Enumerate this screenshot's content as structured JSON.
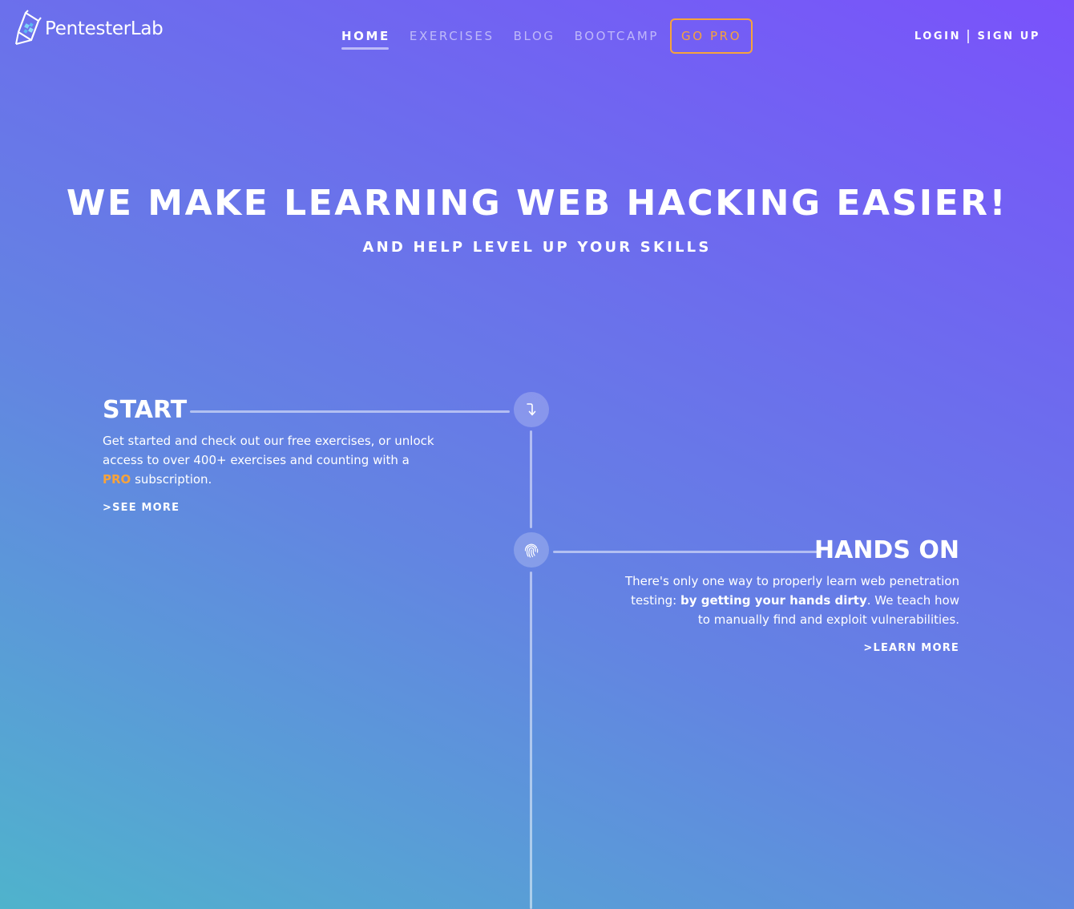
{
  "header": {
    "logo_text": "PentesterLab",
    "nav": [
      {
        "label": "HOME",
        "active": true
      },
      {
        "label": "EXERCISES",
        "active": false
      },
      {
        "label": "BLOG",
        "active": false
      },
      {
        "label": "BOOTCAMP",
        "active": false
      }
    ],
    "pro_label": "GO PRO",
    "login_label": "LOGIN",
    "separator": "|",
    "signup_label": "SIGN UP"
  },
  "hero": {
    "title": "WE MAKE LEARNING WEB HACKING EASIER!",
    "subtitle": "AND HELP LEVEL UP YOUR SKILLS"
  },
  "timeline": {
    "start": {
      "title": "START",
      "text_before": "Get started and check out our free exercises, or unlock access to over 400+ exercises and counting with a ",
      "highlight": "PRO",
      "text_after": " subscription.",
      "link": ">SEE MORE",
      "icon": "arrow-turn-down-icon"
    },
    "hands_on": {
      "title": "HANDS ON",
      "text_before": "There's only one way to properly learn web penetration testing: ",
      "bold": "by getting your hands dirty",
      "text_after": ". We teach how to manually find and exploit vulnerabilities.",
      "link": ">LEARN MORE",
      "icon": "fingerprint-icon"
    }
  },
  "colors": {
    "accent": "#f7a33b",
    "gradient_top": "#7a52fb",
    "gradient_bottom": "#4fb3cc"
  }
}
